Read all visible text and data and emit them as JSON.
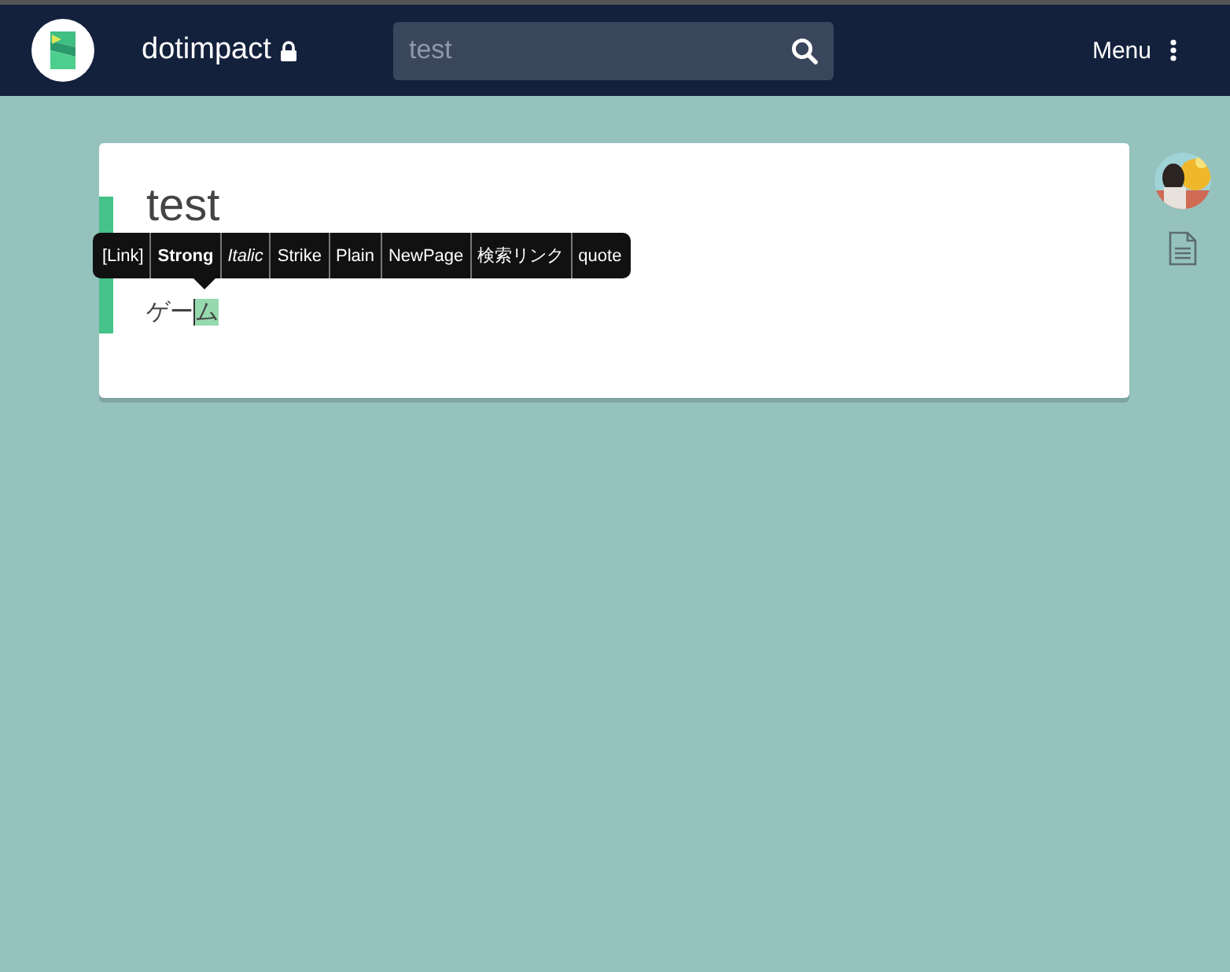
{
  "header": {
    "project": "dotimpact",
    "private": true,
    "search": {
      "value": "test"
    },
    "menu": "Menu"
  },
  "page": {
    "title": "test",
    "line": {
      "before": "ゲー",
      "selected": "ム"
    }
  },
  "toolbar": [
    {
      "label": "[Link]",
      "kind": "plain"
    },
    {
      "label": "Strong",
      "kind": "bold"
    },
    {
      "label": "Italic",
      "kind": "italic"
    },
    {
      "label": "Strike",
      "kind": "plain"
    },
    {
      "label": "Plain",
      "kind": "plain"
    },
    {
      "label": "NewPage",
      "kind": "plain"
    },
    {
      "label": "検索リンク",
      "kind": "plain"
    },
    {
      "label": "quote",
      "kind": "plain"
    }
  ]
}
